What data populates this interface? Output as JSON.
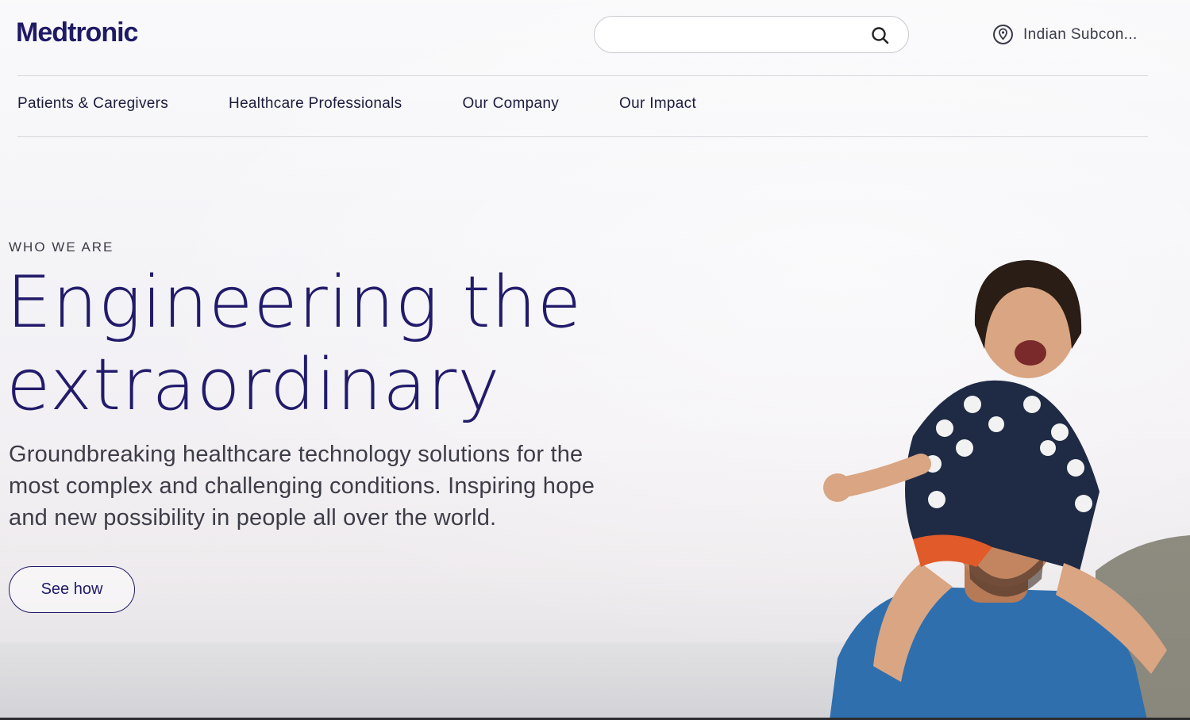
{
  "header": {
    "logo": "Medtronic",
    "search": {
      "value": "",
      "placeholder": ""
    },
    "region": "Indian Subcon..."
  },
  "nav": {
    "items": [
      {
        "label": "Patients & Caregivers"
      },
      {
        "label": "Healthcare Professionals"
      },
      {
        "label": "Our Company"
      },
      {
        "label": "Our Impact"
      }
    ]
  },
  "hero": {
    "eyebrow": "WHO WE ARE",
    "headline_line1": "Engineering the",
    "headline_line2": "extraordinary",
    "subcopy": "Groundbreaking healthcare technology solutions for the most complex and challenging conditions. Inspiring hope and new possibility in people all over the world.",
    "cta": "See how",
    "image": "father-carrying-laughing-daughter-on-shoulders"
  },
  "colors": {
    "brand": "#1f1a66",
    "nav_text": "#1c1b3d",
    "body_text": "#3d3d48"
  },
  "icons": [
    "search-icon",
    "location-pin-icon"
  ]
}
